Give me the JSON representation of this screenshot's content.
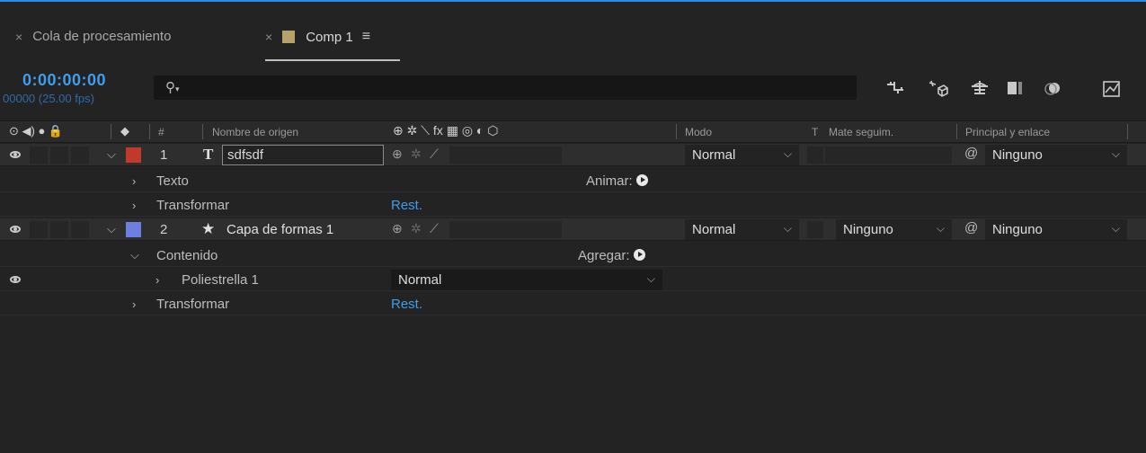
{
  "tabs": [
    {
      "label": "Cola de procesamiento",
      "close": "×",
      "active": false
    },
    {
      "label": "Comp 1",
      "close": "×",
      "active": true,
      "swatch_color": "#b4a26a",
      "menu_icon": "≡"
    }
  ],
  "time": {
    "timecode": "0:00:00:00",
    "frames": "00000 (25.00 fps)"
  },
  "search": {
    "icon": "⌕",
    "caret": "▾",
    "value": ""
  },
  "toolbar_icons": [
    "comp-mini-flowchart-icon",
    "draft-3d-icon",
    "shy-layers-icon",
    "frame-blending-icon",
    "motion-blur-icon",
    "graph-editor-icon"
  ],
  "columns": {
    "hash": "#",
    "source_name": "Nombre de origen",
    "switches": "⊕ ✲ ⟍ fx ▦ ◎ ◐ ⬡",
    "mode": "Modo",
    "t": "T",
    "track_matte": "Mate seguim.",
    "parent": "Principal y enlace"
  },
  "layers": [
    {
      "index": "1",
      "type_icon": "T",
      "name": "sdfsdf",
      "label_color": "#c0392b",
      "mode": "Normal",
      "track_matte": "",
      "parent": "Ninguno",
      "children": [
        {
          "label": "Texto",
          "action": "Animar:"
        },
        {
          "label": "Transformar",
          "action": "Rest."
        }
      ]
    },
    {
      "index": "2",
      "type_icon": "★",
      "name": "Capa de formas 1",
      "label_color": "#6d7fe0",
      "mode": "Normal",
      "track_matte": "Ninguno",
      "parent": "Ninguno",
      "children": [
        {
          "label": "Contenido",
          "action": "Agregar:"
        },
        {
          "label": "Poliestrella 1",
          "blend": "Normal"
        },
        {
          "label": "Transformar",
          "action": "Rest."
        }
      ]
    }
  ]
}
